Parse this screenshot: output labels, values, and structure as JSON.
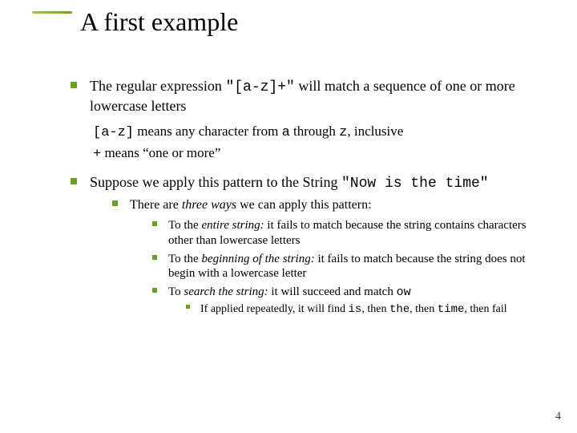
{
  "title": "A first example",
  "bullet1": {
    "pre": "The regular expression ",
    "code": "\"[a-z]+\"",
    "post": " will match a sequence of one or more lowercase letters"
  },
  "sub1a": {
    "code1": "[a-z]",
    "mid": " means any character from ",
    "codeA": "a",
    "mid2": " through ",
    "codeZ": "z",
    "post": ", inclusive"
  },
  "sub1b": {
    "code": "+",
    "post": " means “one or more”"
  },
  "bullet2": {
    "pre": "Suppose we apply this pattern to the String ",
    "code": "\"Now is the time\""
  },
  "b2a": {
    "pre": "There are ",
    "em": "three ways",
    "post": " we can apply this pattern:"
  },
  "b2a1": {
    "pre": "To the ",
    "em": "entire string:",
    "post": " it fails to match because the string contains characters other than lowercase letters"
  },
  "b2a2": {
    "pre": "To the ",
    "em": "beginning of the string:",
    "post": " it fails to match because the string does not begin with a lowercase letter"
  },
  "b2a3": {
    "pre": "To ",
    "em": "search the string:",
    "post": " it will succeed and match ",
    "code": "ow"
  },
  "b2a3a": {
    "pre": "If applied repeatedly, it will find ",
    "c1": "is",
    "m1": ", then ",
    "c2": "the",
    "m2": ", then ",
    "c3": "time",
    "m3": ", then fail"
  },
  "page": "4"
}
